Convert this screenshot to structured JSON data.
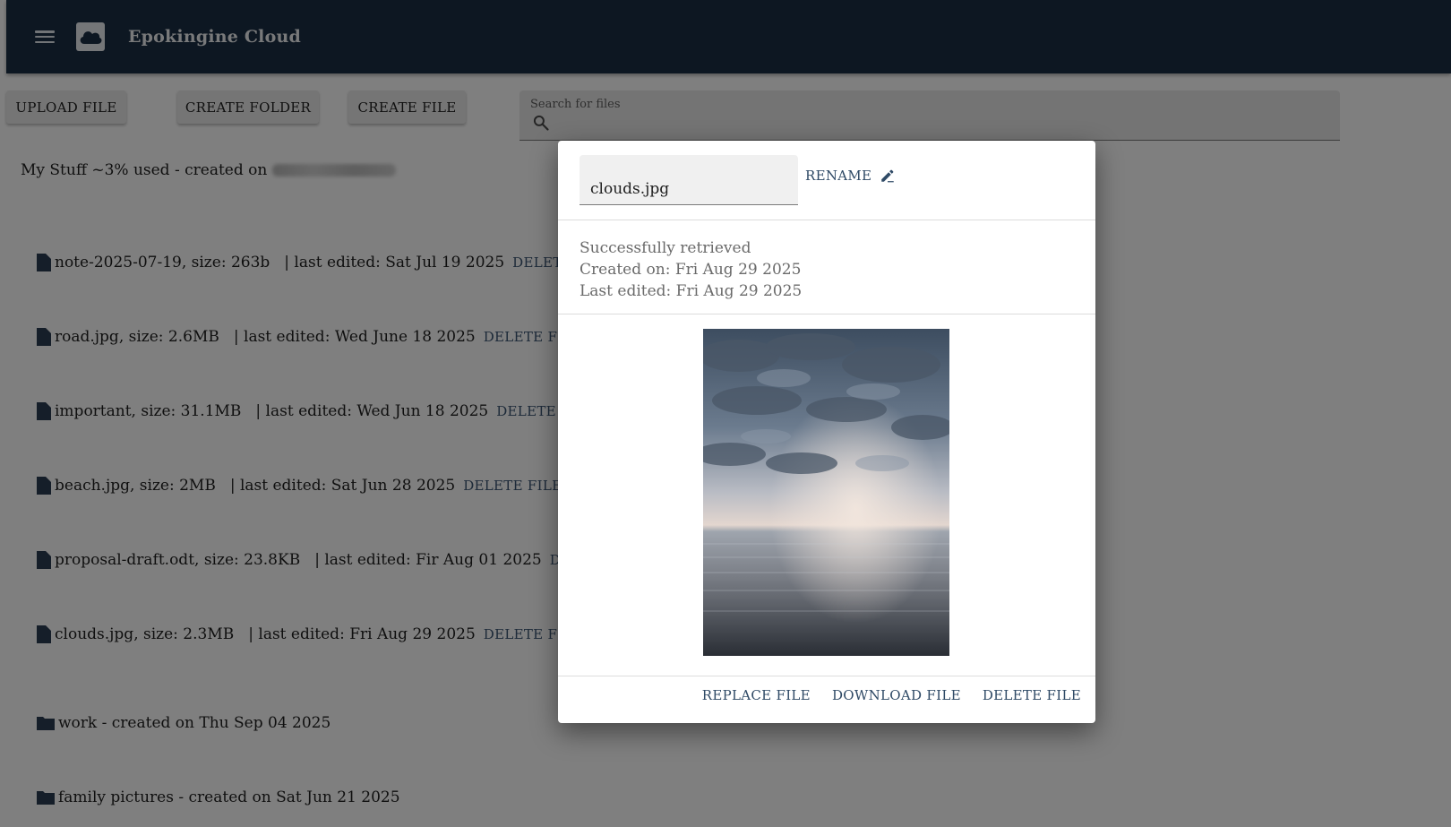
{
  "header": {
    "title": "Epokingine Cloud"
  },
  "toolbar": {
    "upload_label": "UPLOAD FILE",
    "create_folder_label": "CREATE FOLDER",
    "create_file_label": "CREATE FILE"
  },
  "search": {
    "label": "Search for files",
    "value": ""
  },
  "storage": {
    "text": "My Stuff ~3% used - created on"
  },
  "files": [
    {
      "name": "note-2025-07-19, size: 263b",
      "edited": "| last edited: Sat Jul 19 2025",
      "delete": "DELETE FI"
    },
    {
      "name": "road.jpg, size: 2.6MB",
      "edited": "| last edited: Wed June 18 2025",
      "delete": "DELETE FILE"
    },
    {
      "name": "important, size: 31.1MB",
      "edited": "| last edited: Wed Jun 18 2025",
      "delete": "DELETE FILE"
    },
    {
      "name": "beach.jpg, size: 2MB",
      "edited": "| last edited: Sat Jun 28 2025",
      "delete": "DELETE FILE"
    },
    {
      "name": "proposal-draft.odt, size: 23.8KB",
      "edited": "| last edited: Fir Aug 01 2025",
      "delete": "DELE"
    },
    {
      "name": "clouds.jpg, size: 2.3MB",
      "edited": "| last edited: Fri Aug 29 2025",
      "delete": "DELETE FILE"
    }
  ],
  "folders": [
    {
      "text": "work - created on Thu Sep 04 2025"
    },
    {
      "text": "family pictures - created on Sat Jun 21 2025"
    }
  ],
  "dialog": {
    "filename": "clouds.jpg",
    "rename_label": "RENAME",
    "status": "Successfully retrieved",
    "created": "Created on: Fri Aug 29 2025",
    "edited": "Last edited: Fri Aug 29 2025",
    "replace_label": "REPLACE FILE",
    "download_label": "DOWNLOAD FILE",
    "delete_label": "DELETE FILE"
  },
  "colors": {
    "appbar": "#1b2e44",
    "accent_text": "#2f4a66",
    "overlay": "rgba(0,0,0,0.5)"
  },
  "icons": {
    "menu": "menu-icon",
    "logo": "cloud-icon",
    "search": "search-icon",
    "file": "file-icon",
    "folder": "folder-icon",
    "rename": "edit-pencil-icon"
  }
}
